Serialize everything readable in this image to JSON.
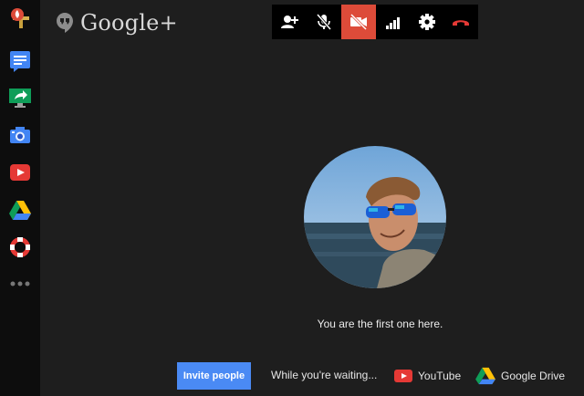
{
  "header": {
    "logo_text": "Google+"
  },
  "sidebar": {
    "items": [
      {
        "name": "hangouts-app-icon",
        "icon": "hangouts-logo"
      },
      {
        "name": "docs-app-icon",
        "icon": "google-docs"
      },
      {
        "name": "screenshare-app-icon",
        "icon": "screenshare"
      },
      {
        "name": "capture-app-icon",
        "icon": "camera"
      },
      {
        "name": "youtube-app-icon",
        "icon": "youtube"
      },
      {
        "name": "drive-app-icon",
        "icon": "google-drive"
      },
      {
        "name": "help-app-icon",
        "icon": "lifebuoy"
      },
      {
        "name": "more-apps-icon",
        "icon": "more-dots"
      }
    ]
  },
  "toolbar": {
    "buttons": [
      {
        "name": "invite-person-icon",
        "active": false
      },
      {
        "name": "mute-mic-icon",
        "active": false
      },
      {
        "name": "camera-off-icon",
        "active": true
      },
      {
        "name": "bandwidth-icon",
        "active": false
      },
      {
        "name": "settings-icon",
        "active": false
      },
      {
        "name": "hang-up-icon",
        "active": false
      }
    ],
    "active_color": "#dd4b39"
  },
  "main": {
    "status_text": "You are the first one here.",
    "invite_button_label": "Invite people",
    "waiting_text": "While you're waiting...",
    "apps": [
      {
        "label": "YouTube",
        "icon": "youtube-icon"
      },
      {
        "label": "Google Drive",
        "icon": "google-drive-icon"
      }
    ]
  },
  "colors": {
    "accent": "#4a8af4",
    "background": "#1e1e1e",
    "sidebar": "#0d0d0d"
  }
}
